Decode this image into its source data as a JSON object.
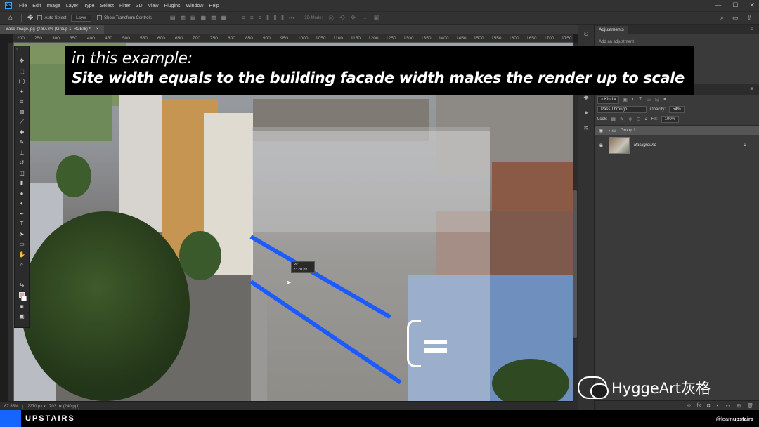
{
  "app": {
    "logo": "Ps",
    "menu": [
      "File",
      "Edit",
      "Image",
      "Layer",
      "Type",
      "Select",
      "Filter",
      "3D",
      "View",
      "Plugins",
      "Window",
      "Help"
    ]
  },
  "options_bar": {
    "auto_select_label": "Auto-Select:",
    "auto_select_value": "Layer",
    "transform_controls_label": "Show Transform Controls",
    "mode_3d_label": "3D Mode:"
  },
  "document": {
    "tab_title": "Base Image.jpg @ 87.8% (Group 1, RGB/8) *",
    "tab_close": "×",
    "ruler_ticks": [
      "200",
      "250",
      "300",
      "350",
      "400",
      "450",
      "500",
      "550",
      "600",
      "650",
      "700",
      "750",
      "800",
      "850",
      "900",
      "950",
      "1000",
      "1050",
      "1100",
      "1150",
      "1200",
      "1250",
      "1300",
      "1350",
      "1400",
      "1450",
      "1500",
      "1550",
      "1600",
      "1650",
      "1700",
      "1750"
    ]
  },
  "status": {
    "zoom": "87.85%",
    "doc_info": "2270 px x 1703 px (240 ppi)"
  },
  "caption": {
    "line1": "in this example:",
    "line2": "Site width equals to the building facade width makes the render up to scale"
  },
  "tooltip": {
    "line1": "W: ...",
    "line2": "↕: 20 px"
  },
  "panels": {
    "adjustments_tab": "Adjustments",
    "adjustments_hint": "Add an adjustment",
    "kind_label": "Kind",
    "blend_mode": "Pass Through",
    "opacity_label": "Opacity:",
    "opacity_value": "54%",
    "lock_label": "Lock:",
    "fill_label": "Fill:",
    "fill_value": "100%",
    "layers": [
      {
        "name": "Group 1",
        "type": "group",
        "selected": true
      },
      {
        "name": "Background",
        "type": "image",
        "selected": false,
        "locked": true
      }
    ]
  },
  "watermark": {
    "text": "HyggeArt灰格"
  },
  "footer": {
    "brand": "UPSTAIRS",
    "handle_prefix": "@learn",
    "handle_bold": "upstairs"
  },
  "colors": {
    "accent_blue": "#1e5bff",
    "brand_blue": "#1565ff"
  }
}
